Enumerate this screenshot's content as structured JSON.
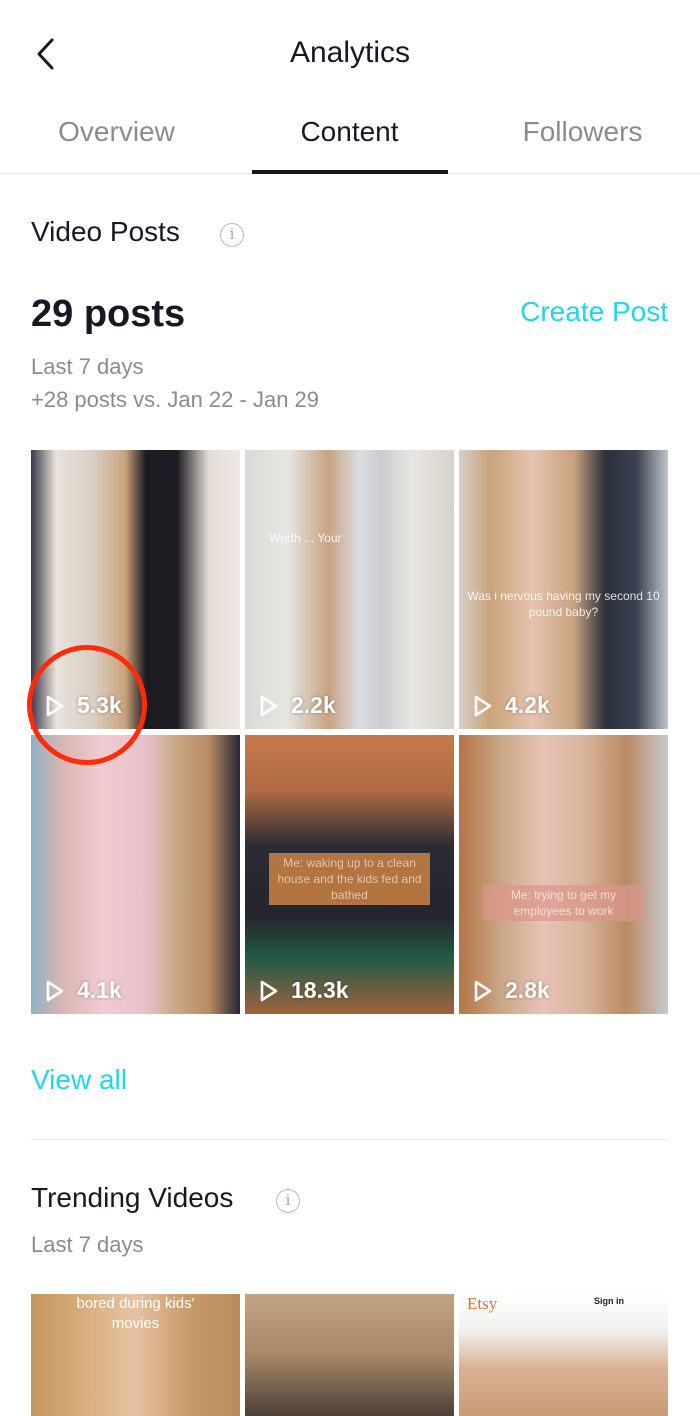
{
  "header": {
    "title": "Analytics",
    "back_icon": "chevron-left-icon"
  },
  "tabs": [
    {
      "label": "Overview",
      "active": false
    },
    {
      "label": "Content",
      "active": true
    },
    {
      "label": "Followers",
      "active": false
    }
  ],
  "video_posts": {
    "title": "Video Posts",
    "info_icon": "info-icon",
    "count": "29 posts",
    "create_post": "Create Post",
    "period": "Last 7 days",
    "comparison": "+28 posts vs. Jan 22 - Jan 29",
    "videos": [
      {
        "views": "5.3k",
        "caption": ""
      },
      {
        "views": "2.2k",
        "caption": "Worth ... Your"
      },
      {
        "views": "4.2k",
        "caption": "Was i nervous having my second 10 pound baby?"
      },
      {
        "views": "4.1k",
        "caption": ""
      },
      {
        "views": "18.3k",
        "caption": "Me: waking up to a clean house and the kids fed and bathed"
      },
      {
        "views": "2.8k",
        "caption": "Me: trying to get my employees to work"
      }
    ],
    "view_all": "View all"
  },
  "trending": {
    "title": "Trending Videos",
    "period": "Last 7 days",
    "videos": [
      {
        "caption": "bored during kids' movies"
      },
      {
        "caption": ""
      },
      {
        "caption": "Etsy",
        "overlay_text": "Sign in"
      }
    ]
  },
  "colors": {
    "accent": "#20d5ec",
    "text_primary": "#161823",
    "text_secondary": "#8a8b91",
    "highlight": "#fe2c0a"
  }
}
